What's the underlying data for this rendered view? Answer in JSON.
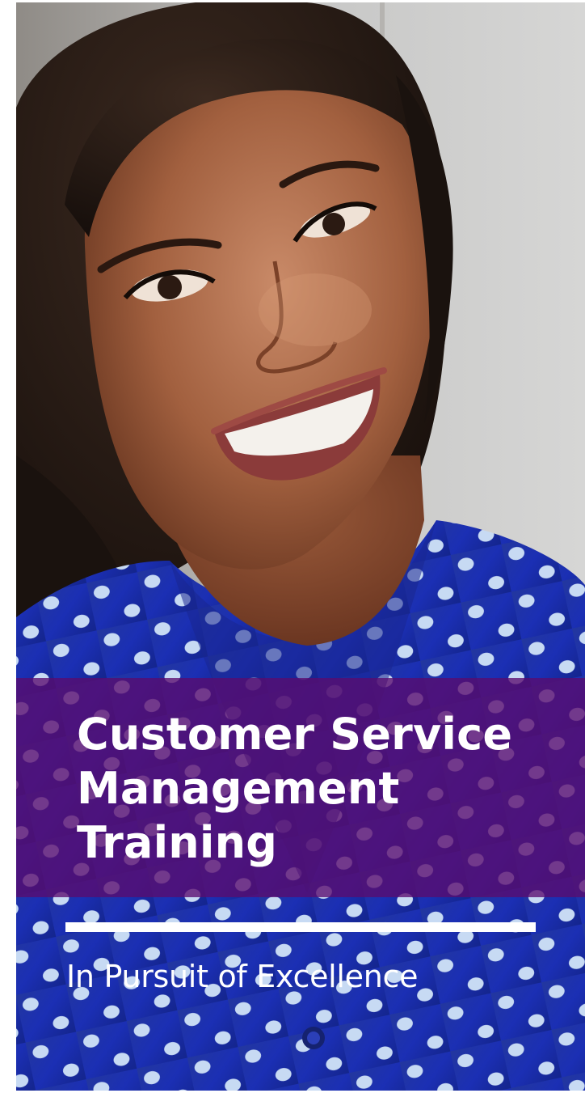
{
  "cover": {
    "title_lines": [
      "Customer Service",
      "Management",
      "Training"
    ],
    "tagline": "In Pursuit of Excellence"
  },
  "photo": {
    "subject": "smiling woman in blue polka-dot blouse",
    "colors": {
      "wall": "#cfcfcf",
      "shirt": "#1d2fae",
      "skin": "#b8714f",
      "hair": "#2a1c14"
    }
  },
  "colors": {
    "band": "#5a0c6e",
    "text": "#ffffff",
    "divider": "#ffffff"
  }
}
